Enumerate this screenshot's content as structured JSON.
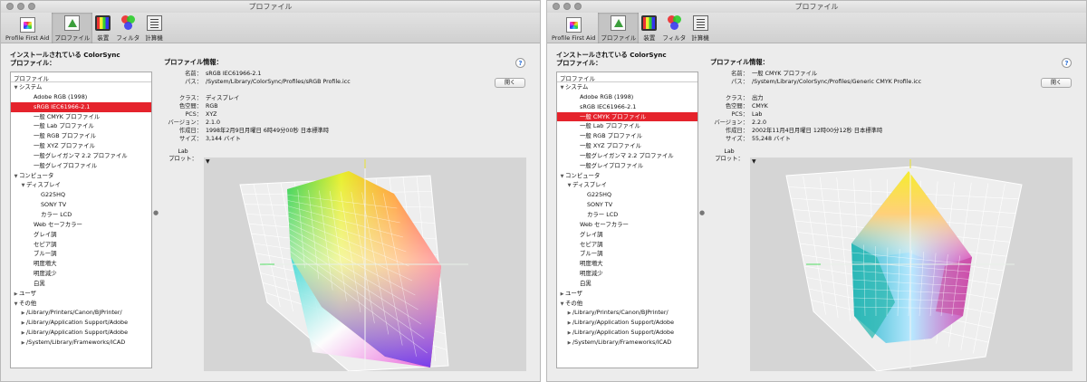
{
  "windows": [
    {
      "title": "プロファイル",
      "toolbar": [
        {
          "label": "Profile First Aid",
          "icon": "profile-first-aid-icon",
          "active": false
        },
        {
          "label": "プロファイル",
          "icon": "profiles-icon",
          "active": true
        },
        {
          "label": "装置",
          "icon": "devices-icon",
          "active": false
        },
        {
          "label": "フィルタ",
          "icon": "filters-icon",
          "active": false
        },
        {
          "label": "計算機",
          "icon": "calculator-icon",
          "active": false
        }
      ],
      "panel_title_line1": "インストールされている ColorSync",
      "panel_title_line2": "プロファイル：",
      "tree_header": "プロファイル",
      "tree": [
        {
          "text": "システム",
          "level": 0,
          "tri": "down"
        },
        {
          "text": "Adobe RGB (1998)",
          "level": 2,
          "tri": ""
        },
        {
          "text": "sRGB IEC61966-2.1",
          "level": 2,
          "tri": "",
          "selected": true
        },
        {
          "text": "一般 CMYK プロファイル",
          "level": 2,
          "tri": ""
        },
        {
          "text": "一般 Lab プロファイル",
          "level": 2,
          "tri": ""
        },
        {
          "text": "一般 RGB プロファイル",
          "level": 2,
          "tri": ""
        },
        {
          "text": "一般 XYZ プロファイル",
          "level": 2,
          "tri": ""
        },
        {
          "text": "一般グレイガンマ 2.2 プロファイル",
          "level": 2,
          "tri": ""
        },
        {
          "text": "一般グレイプロファイル",
          "level": 2,
          "tri": ""
        },
        {
          "text": "コンピュータ",
          "level": 0,
          "tri": "down"
        },
        {
          "text": "ディスプレイ",
          "level": 1,
          "tri": "down"
        },
        {
          "text": "G225HQ",
          "level": 3,
          "tri": ""
        },
        {
          "text": "SONY TV",
          "level": 3,
          "tri": ""
        },
        {
          "text": "カラー LCD",
          "level": 3,
          "tri": ""
        },
        {
          "text": "Web セーフカラー",
          "level": 2,
          "tri": ""
        },
        {
          "text": "グレイ調",
          "level": 2,
          "tri": ""
        },
        {
          "text": "セピア調",
          "level": 2,
          "tri": ""
        },
        {
          "text": "ブルー調",
          "level": 2,
          "tri": ""
        },
        {
          "text": "明度増大",
          "level": 2,
          "tri": ""
        },
        {
          "text": "明度減少",
          "level": 2,
          "tri": ""
        },
        {
          "text": "白黒",
          "level": 2,
          "tri": ""
        },
        {
          "text": "ユーザ",
          "level": 0,
          "tri": "right"
        },
        {
          "text": "その他",
          "level": 0,
          "tri": "down"
        },
        {
          "text": "/Library/Printers/Canon/BJPrinter/",
          "level": 1,
          "tri": "right"
        },
        {
          "text": "/Library/Application Support/Adobe",
          "level": 1,
          "tri": "right"
        },
        {
          "text": "/Library/Application Support/Adobe",
          "level": 1,
          "tri": "right"
        },
        {
          "text": "/System/Library/Frameworks/ICAD",
          "level": 1,
          "tri": "right"
        }
      ],
      "info_heading": "プロファイル情報：",
      "help_label": "?",
      "open_button": "開く",
      "info": [
        {
          "key": "名前：",
          "value": "sRGB IEC61966-2.1"
        },
        {
          "key": "パス：",
          "value": "/System/Library/ColorSync/Profiles/sRGB Profile.icc"
        },
        {
          "key": "クラス：",
          "value": "ディスプレイ"
        },
        {
          "key": "色空間：",
          "value": "RGB"
        },
        {
          "key": "PCS：",
          "value": "XYZ"
        },
        {
          "key": "バージョン：",
          "value": "2.1.0"
        },
        {
          "key": "作成日：",
          "value": "1998年2月9日月曜日 6時49分00秒 日本標準時"
        },
        {
          "key": "サイズ：",
          "value": "3,144 バイト"
        }
      ],
      "lab_label_line1": "Lab",
      "lab_label_line2": "プロット：",
      "plot_menu": "▼",
      "gamut": "srgb"
    },
    {
      "title": "プロファイル",
      "toolbar": [
        {
          "label": "Profile First Aid",
          "icon": "profile-first-aid-icon",
          "active": false
        },
        {
          "label": "プロファイル",
          "icon": "profiles-icon",
          "active": true
        },
        {
          "label": "装置",
          "icon": "devices-icon",
          "active": false
        },
        {
          "label": "フィルタ",
          "icon": "filters-icon",
          "active": false
        },
        {
          "label": "計算機",
          "icon": "calculator-icon",
          "active": false
        }
      ],
      "panel_title_line1": "インストールされている ColorSync",
      "panel_title_line2": "プロファイル：",
      "tree_header": "プロファイル",
      "tree": [
        {
          "text": "システム",
          "level": 0,
          "tri": "down"
        },
        {
          "text": "Adobe RGB (1998)",
          "level": 2,
          "tri": ""
        },
        {
          "text": "sRGB IEC61966-2.1",
          "level": 2,
          "tri": ""
        },
        {
          "text": "一般 CMYK プロファイル",
          "level": 2,
          "tri": "",
          "selected": true
        },
        {
          "text": "一般 Lab プロファイル",
          "level": 2,
          "tri": ""
        },
        {
          "text": "一般 RGB プロファイル",
          "level": 2,
          "tri": ""
        },
        {
          "text": "一般 XYZ プロファイル",
          "level": 2,
          "tri": ""
        },
        {
          "text": "一般グレイガンマ 2.2 プロファイル",
          "level": 2,
          "tri": ""
        },
        {
          "text": "一般グレイプロファイル",
          "level": 2,
          "tri": ""
        },
        {
          "text": "コンピュータ",
          "level": 0,
          "tri": "down"
        },
        {
          "text": "ディスプレイ",
          "level": 1,
          "tri": "down"
        },
        {
          "text": "G225HQ",
          "level": 3,
          "tri": ""
        },
        {
          "text": "SONY TV",
          "level": 3,
          "tri": ""
        },
        {
          "text": "カラー LCD",
          "level": 3,
          "tri": ""
        },
        {
          "text": "Web セーフカラー",
          "level": 2,
          "tri": ""
        },
        {
          "text": "グレイ調",
          "level": 2,
          "tri": ""
        },
        {
          "text": "セピア調",
          "level": 2,
          "tri": ""
        },
        {
          "text": "ブルー調",
          "level": 2,
          "tri": ""
        },
        {
          "text": "明度増大",
          "level": 2,
          "tri": ""
        },
        {
          "text": "明度減少",
          "level": 2,
          "tri": ""
        },
        {
          "text": "白黒",
          "level": 2,
          "tri": ""
        },
        {
          "text": "ユーザ",
          "level": 0,
          "tri": "right"
        },
        {
          "text": "その他",
          "level": 0,
          "tri": "down"
        },
        {
          "text": "/Library/Printers/Canon/BJPrinter/",
          "level": 1,
          "tri": "right"
        },
        {
          "text": "/Library/Application Support/Adobe",
          "level": 1,
          "tri": "right"
        },
        {
          "text": "/Library/Application Support/Adobe",
          "level": 1,
          "tri": "right"
        },
        {
          "text": "/System/Library/Frameworks/ICAD",
          "level": 1,
          "tri": "right"
        }
      ],
      "info_heading": "プロファイル情報：",
      "help_label": "?",
      "open_button": "開く",
      "info": [
        {
          "key": "名前：",
          "value": "一般 CMYK プロファイル"
        },
        {
          "key": "パス：",
          "value": "/System/Library/ColorSync/Profiles/Generic CMYK Profile.icc"
        },
        {
          "key": "クラス：",
          "value": "出力"
        },
        {
          "key": "色空間：",
          "value": "CMYK"
        },
        {
          "key": "PCS：",
          "value": "Lab"
        },
        {
          "key": "バージョン：",
          "value": "2.2.0"
        },
        {
          "key": "作成日：",
          "value": "2002年11月4日月曜日 12時00分12秒 日本標準時"
        },
        {
          "key": "サイズ：",
          "value": "55,248 バイト"
        }
      ],
      "lab_label_line1": "Lab",
      "lab_label_line2": "プロット：",
      "plot_menu": "▼",
      "gamut": "cmyk"
    }
  ],
  "colors": {
    "selection": "#e5232c",
    "window_bg": "#ececec",
    "plot_bg": "#d5d5d5"
  }
}
